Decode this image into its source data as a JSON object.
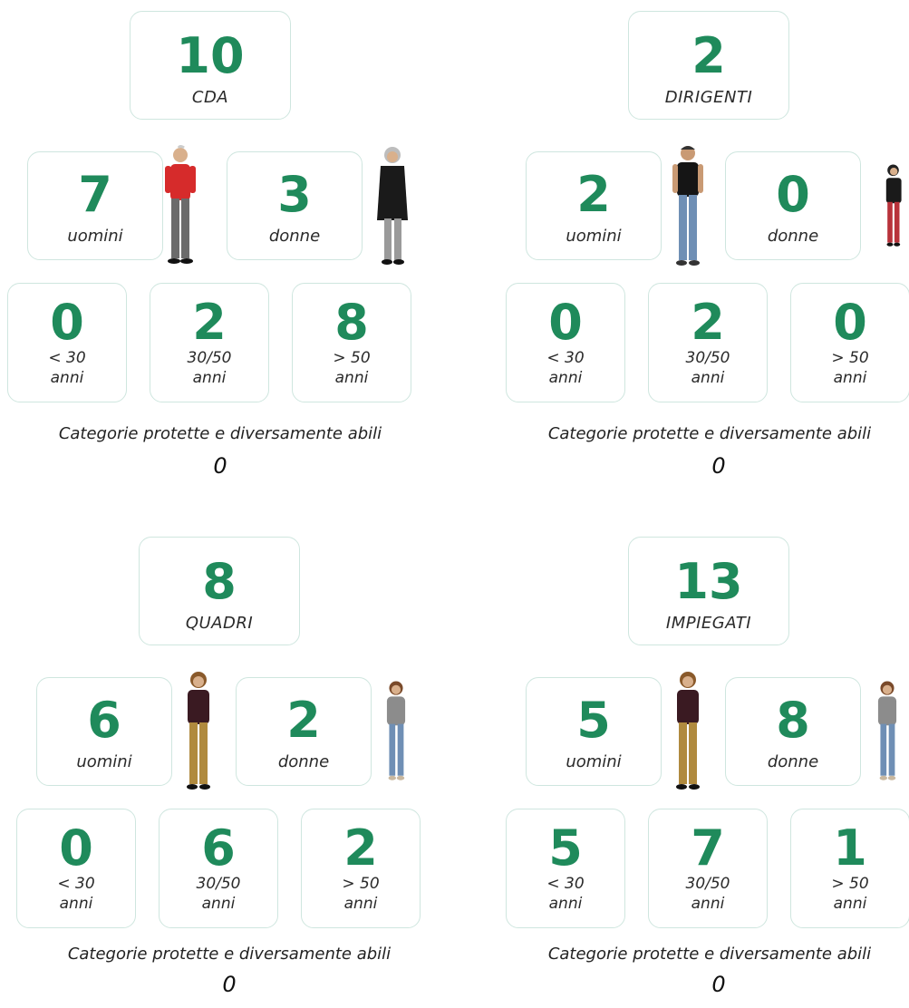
{
  "colors": {
    "accent": "#1f8a5b",
    "border": "#cfe6df"
  },
  "panels": [
    {
      "total": "10",
      "title": "CDA",
      "men": {
        "value": "7",
        "label": "uomini"
      },
      "women": {
        "value": "3",
        "label": "donne"
      },
      "ages": [
        {
          "value": "0",
          "l1": "< 30",
          "l2": "anni"
        },
        {
          "value": "2",
          "l1": "30/50",
          "l2": "anni"
        },
        {
          "value": "8",
          "l1": "> 50",
          "l2": "anni"
        }
      ],
      "category_label": "Categorie protette e diversamente abili",
      "category_value": "0"
    },
    {
      "total": "2",
      "title": "DIRIGENTI",
      "men": {
        "value": "2",
        "label": "uomini"
      },
      "women": {
        "value": "0",
        "label": "donne"
      },
      "ages": [
        {
          "value": "0",
          "l1": "< 30",
          "l2": "anni"
        },
        {
          "value": "2",
          "l1": "30/50",
          "l2": "anni"
        },
        {
          "value": "0",
          "l1": "> 50",
          "l2": "anni"
        }
      ],
      "category_label": "Categorie protette e diversamente abili",
      "category_value": "0"
    },
    {
      "total": "8",
      "title": "QUADRI",
      "men": {
        "value": "6",
        "label": "uomini"
      },
      "women": {
        "value": "2",
        "label": "donne"
      },
      "ages": [
        {
          "value": "0",
          "l1": "< 30",
          "l2": "anni"
        },
        {
          "value": "6",
          "l1": "30/50",
          "l2": "anni"
        },
        {
          "value": "2",
          "l1": "> 50",
          "l2": "anni"
        }
      ],
      "category_label": "Categorie protette e diversamente abili",
      "category_value": "0"
    },
    {
      "total": "13",
      "title": "IMPIEGATI",
      "men": {
        "value": "5",
        "label": "uomini"
      },
      "women": {
        "value": "8",
        "label": "donne"
      },
      "ages": [
        {
          "value": "5",
          "l1": "< 30",
          "l2": "anni"
        },
        {
          "value": "7",
          "l1": "30/50",
          "l2": "anni"
        },
        {
          "value": "1",
          "l1": "> 50",
          "l2": "anni"
        }
      ],
      "category_label": "Categorie protette e diversamente abili",
      "category_value": "0"
    }
  ]
}
